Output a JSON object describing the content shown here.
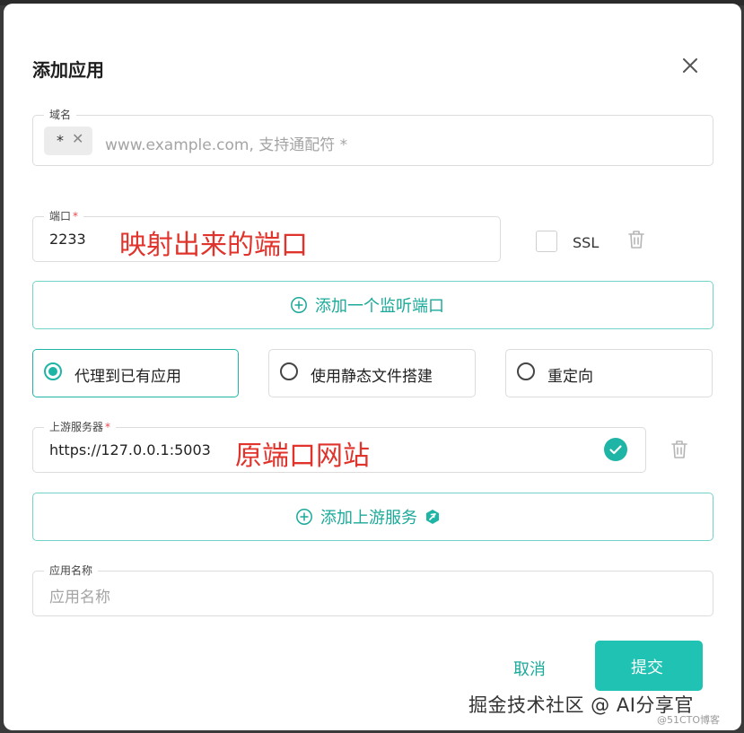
{
  "dialog": {
    "title": "添加应用",
    "close_icon": "close-icon"
  },
  "domain": {
    "label": "域名",
    "chip": "*",
    "chip_remove_icon": "close-small-icon",
    "placeholder": "www.example.com, 支持通配符 *"
  },
  "port": {
    "label": "端口",
    "required_mark": "*",
    "value": "2233",
    "annotation": "映射出来的端口",
    "ssl_label": "SSL",
    "ssl_checked": false,
    "delete_icon": "trash-icon"
  },
  "add_listen_port": {
    "label": "添加一个监听端口",
    "icon": "plus-circle-icon"
  },
  "mode": {
    "options": [
      "代理到已有应用",
      "使用静态文件搭建",
      "重定向"
    ],
    "selected_index": 0
  },
  "upstream": {
    "label": "上游服务器",
    "required_mark": "*",
    "value": "https://127.0.0.1:5003",
    "annotation": "原端口网站",
    "status_icon": "check-circle-icon",
    "delete_icon": "trash-icon"
  },
  "add_upstream": {
    "label": "添加上游服务",
    "icon": "plus-circle-icon",
    "badge_icon": "pro-badge-icon"
  },
  "app_name": {
    "label": "应用名称",
    "placeholder": "应用名称"
  },
  "footer": {
    "cancel": "取消",
    "submit": "提交"
  },
  "watermark": {
    "main": "掘金技术社区 @ AI分享官",
    "sub": "@51CTO博客"
  },
  "colors": {
    "accent": "#1fb5a6",
    "annotation": "#e0332b",
    "required": "#e5484d"
  }
}
